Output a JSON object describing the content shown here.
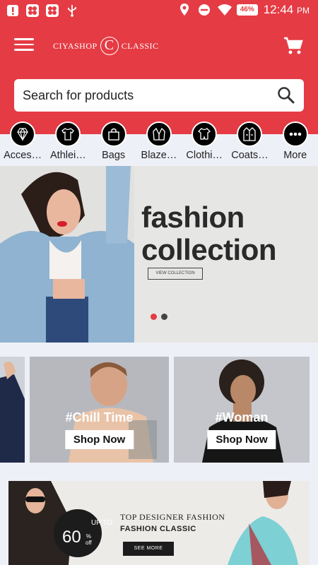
{
  "status_bar": {
    "battery": "46%",
    "time": "12:44",
    "ampm": "PM"
  },
  "header": {
    "logo_left": "CIYASHOP",
    "logo_mark": "C",
    "logo_right": "CLASSIC"
  },
  "search": {
    "placeholder": "Search for products"
  },
  "categories": [
    {
      "label": "Acces…",
      "icon": "diamond-icon"
    },
    {
      "label": "Athlei…",
      "icon": "tshirt-icon"
    },
    {
      "label": "Bags",
      "icon": "bag-icon"
    },
    {
      "label": "Blaze…",
      "icon": "blazer-icon"
    },
    {
      "label": "Clothi…",
      "icon": "baby-clothes-icon"
    },
    {
      "label": "Coats…",
      "icon": "coat-icon"
    },
    {
      "label": "More",
      "icon": "more-dots-icon"
    }
  ],
  "hero": {
    "title_line1": "fashion",
    "title_line2": "collection",
    "button": "VIEW COLLECTION",
    "slide_count": 2,
    "active_slide": 1
  },
  "promos": [
    {
      "tag": "#Chill Time",
      "button": "Shop Now"
    },
    {
      "tag": "#Woman",
      "button": "Shop Now"
    }
  ],
  "banner2": {
    "up_to": "UP TO",
    "discount": "60",
    "percent": "%",
    "off": "off",
    "title": "TOP DESIGNER FASHION",
    "subtitle": "FASHION CLASSIC",
    "button": "SEE MORE"
  },
  "colors": {
    "brand": "#e53b44",
    "background": "#eef0f8",
    "dark": "#1c1c1c"
  }
}
